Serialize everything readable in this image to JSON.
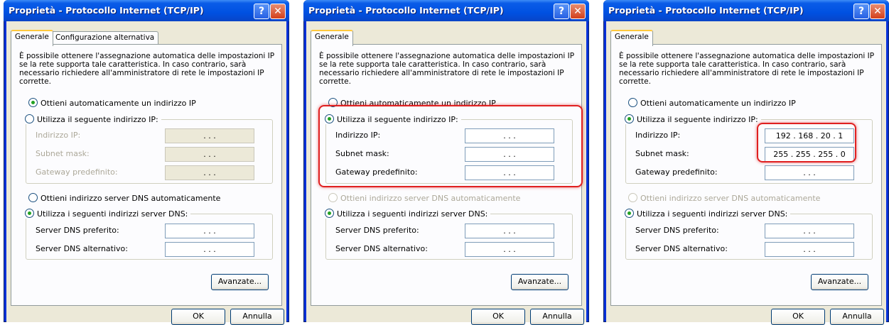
{
  "dialogs": [
    {
      "title": "Proprietà - Protocollo Internet (TCP/IP)",
      "help_label": "?",
      "close_label": "✕",
      "tabs": [
        "Generale",
        "Configurazione alternativa"
      ],
      "description": "È possibile ottenere l'assegnazione automatica delle impostazioni IP se la rete supporta tale caratteristica. In caso contrario, sarà necessario richiedere all'amministratore di rete le impostazioni IP corrette.",
      "ip_auto_label": "Ottieni automaticamente un indirizzo IP",
      "ip_manual_label": "Utilizza il seguente indirizzo IP:",
      "ip_mode": "auto",
      "fields_ip": [
        {
          "label": "Indirizzo IP:",
          "value": ".          .          ."
        },
        {
          "label": "Subnet mask:",
          "value": ".          .          ."
        },
        {
          "label": "Gateway predefinito:",
          "value": ".          .          ."
        }
      ],
      "dns_auto_label": "Ottieni indirizzo server DNS automaticamente",
      "dns_manual_label": "Utilizza i seguenti indirizzi server DNS:",
      "fields_dns": [
        {
          "label": "Server DNS preferito:",
          "value": ".          .          ."
        },
        {
          "label": "Server DNS alternativo:",
          "value": ".          .          ."
        }
      ],
      "advanced_label": "Avanzate...",
      "ok_label": "OK",
      "cancel_label": "Annulla"
    },
    {
      "title": "Proprietà - Protocollo Internet (TCP/IP)",
      "help_label": "?",
      "close_label": "✕",
      "tabs": [
        "Generale"
      ],
      "description": "È possibile ottenere l'assegnazione automatica delle impostazioni IP se la rete supporta tale caratteristica. In caso contrario, sarà necessario richiedere all'amministratore di rete le impostazioni IP corrette.",
      "ip_auto_label": "Ottieni automaticamente un indirizzo IP",
      "ip_manual_label": "Utilizza il seguente indirizzo IP:",
      "ip_mode": "manual",
      "fields_ip": [
        {
          "label": "Indirizzo IP:",
          "value": ".          .          ."
        },
        {
          "label": "Subnet mask:",
          "value": ".          .          ."
        },
        {
          "label": "Gateway predefinito:",
          "value": ".          .          ."
        }
      ],
      "dns_auto_label": "Ottieni indirizzo server DNS automaticamente",
      "dns_manual_label": "Utilizza i seguenti indirizzi server DNS:",
      "fields_dns": [
        {
          "label": "Server DNS preferito:",
          "value": ".          .          ."
        },
        {
          "label": "Server DNS alternativo:",
          "value": ".          .          ."
        }
      ],
      "advanced_label": "Avanzate...",
      "ok_label": "OK",
      "cancel_label": "Annulla"
    },
    {
      "title": "Proprietà - Protocollo Internet (TCP/IP)",
      "help_label": "?",
      "close_label": "✕",
      "tabs": [
        "Generale"
      ],
      "description": "È possibile ottenere l'assegnazione automatica delle impostazioni IP se la rete supporta tale caratteristica. In caso contrario, sarà necessario richiedere all'amministratore di rete le impostazioni IP corrette.",
      "ip_auto_label": "Ottieni automaticamente un indirizzo IP",
      "ip_manual_label": "Utilizza il seguente indirizzo IP:",
      "ip_mode": "manual",
      "fields_ip": [
        {
          "label": "Indirizzo IP:",
          "value": "192 . 168 . 20 . 1"
        },
        {
          "label": "Subnet mask:",
          "value": "255 . 255 . 255 . 0"
        },
        {
          "label": "Gateway predefinito:",
          "value": ".          .          ."
        }
      ],
      "dns_auto_label": "Ottieni indirizzo server DNS automaticamente",
      "dns_manual_label": "Utilizza i seguenti indirizzi server DNS:",
      "fields_dns": [
        {
          "label": "Server DNS preferito:",
          "value": ".          .          ."
        },
        {
          "label": "Server DNS alternativo:",
          "value": ".          .          ."
        }
      ],
      "advanced_label": "Avanzate...",
      "ok_label": "OK",
      "cancel_label": "Annulla"
    }
  ]
}
